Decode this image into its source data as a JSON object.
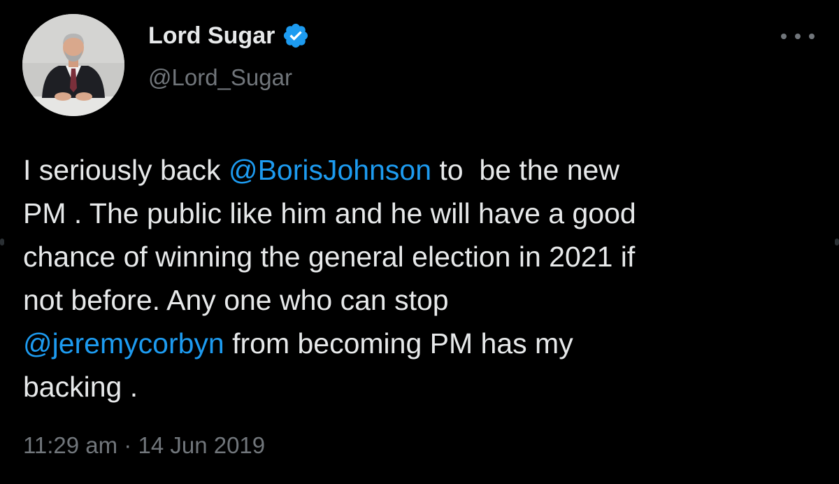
{
  "author": {
    "display_name": "Lord Sugar",
    "handle": "@Lord_Sugar",
    "verified": true,
    "avatar_icon": "profile-photo"
  },
  "menu": {
    "icon": "more-horizontal-icon"
  },
  "tweet": {
    "lines": [
      {
        "pre": "I seriously back ",
        "mention": "@BorisJohnson",
        "post": " to  be the new"
      },
      {
        "pre": "PM . The public like him and he will have a good",
        "mention": "",
        "post": ""
      },
      {
        "pre": "chance of winning the general election in 2021 if",
        "mention": "",
        "post": ""
      },
      {
        "pre": "not before. Any one who can stop",
        "mention": "",
        "post": ""
      },
      {
        "pre": "",
        "mention": "@jeremycorbyn",
        "post": " from becoming PM has my"
      },
      {
        "pre": "backing .",
        "mention": "",
        "post": ""
      }
    ],
    "timestamp": "11:29 am · 14 Jun 2019"
  },
  "colors": {
    "background": "#000000",
    "text": "#e7e9ea",
    "secondary_text": "#71767b",
    "mention": "#1d9bf0",
    "verified_badge": "#1d9bf0"
  }
}
